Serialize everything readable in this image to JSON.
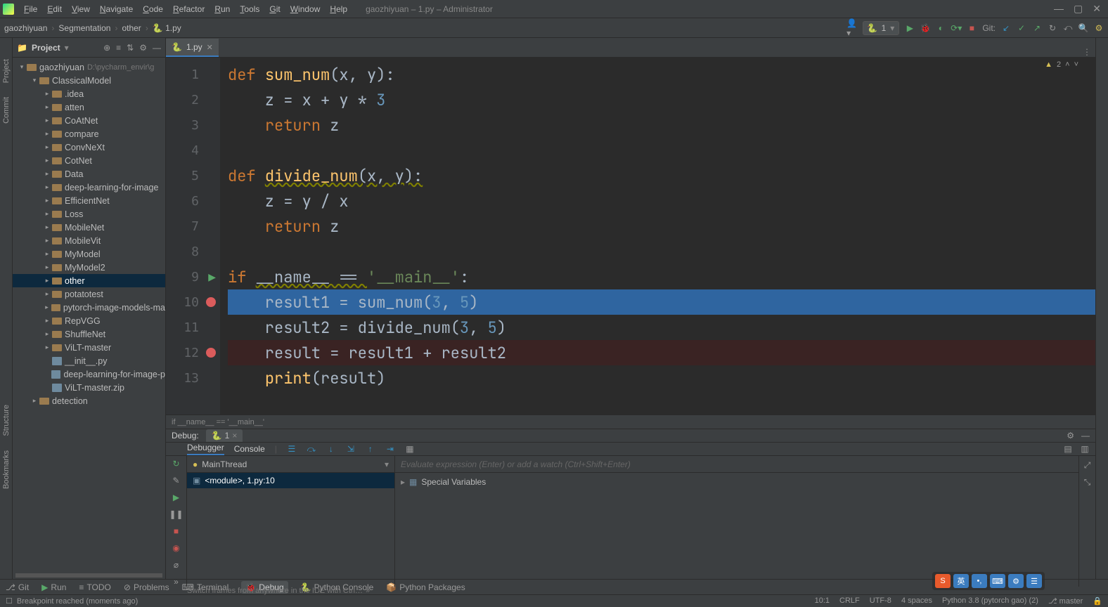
{
  "window": {
    "title": "gaozhiyuan – 1.py – Administrator"
  },
  "menu": [
    "File",
    "Edit",
    "View",
    "Navigate",
    "Code",
    "Refactor",
    "Run",
    "Tools",
    "Git",
    "Window",
    "Help"
  ],
  "breadcrumbs": [
    "gaozhiyuan",
    "Segmentation",
    "other",
    "1.py"
  ],
  "run_config": {
    "label": "1"
  },
  "toolbar_git_label": "Git:",
  "project_panel": {
    "title": "Project"
  },
  "tree": [
    {
      "lvl": 1,
      "caret": "▾",
      "label": "gaozhiyuan",
      "hint": "D:\\pycharm_envir\\g"
    },
    {
      "lvl": 2,
      "caret": "▾",
      "label": "ClassicalModel"
    },
    {
      "lvl": 3,
      "caret": "▸",
      "label": ".idea"
    },
    {
      "lvl": 3,
      "caret": "▸",
      "label": "atten"
    },
    {
      "lvl": 3,
      "caret": "▸",
      "label": "CoAtNet"
    },
    {
      "lvl": 3,
      "caret": "▸",
      "label": "compare"
    },
    {
      "lvl": 3,
      "caret": "▸",
      "label": "ConvNeXt"
    },
    {
      "lvl": 3,
      "caret": "▸",
      "label": "CotNet"
    },
    {
      "lvl": 3,
      "caret": "▸",
      "label": "Data"
    },
    {
      "lvl": 3,
      "caret": "▸",
      "label": "deep-learning-for-image"
    },
    {
      "lvl": 3,
      "caret": "▸",
      "label": "EfficientNet"
    },
    {
      "lvl": 3,
      "caret": "▸",
      "label": "Loss"
    },
    {
      "lvl": 3,
      "caret": "▸",
      "label": "MobileNet"
    },
    {
      "lvl": 3,
      "caret": "▸",
      "label": "MobileVit"
    },
    {
      "lvl": 3,
      "caret": "▸",
      "label": "MyModel"
    },
    {
      "lvl": 3,
      "caret": "▸",
      "label": "MyModel2"
    },
    {
      "lvl": 3,
      "caret": "▸",
      "label": "other",
      "selected": true
    },
    {
      "lvl": 3,
      "caret": "▸",
      "label": "potatotest"
    },
    {
      "lvl": 3,
      "caret": "▸",
      "label": "pytorch-image-models-ma"
    },
    {
      "lvl": 3,
      "caret": "▸",
      "label": "RepVGG"
    },
    {
      "lvl": 3,
      "caret": "▸",
      "label": "ShuffleNet"
    },
    {
      "lvl": 3,
      "caret": "▸",
      "label": "ViLT-master"
    },
    {
      "lvl": 3,
      "caret": "",
      "label": "__init__.py",
      "file": true
    },
    {
      "lvl": 3,
      "caret": "",
      "label": "deep-learning-for-image-p",
      "file": true
    },
    {
      "lvl": 3,
      "caret": "",
      "label": "ViLT-master.zip",
      "file": true
    },
    {
      "lvl": 2,
      "caret": "▸",
      "label": "detection"
    }
  ],
  "tab": {
    "label": "1.py"
  },
  "editor_status": {
    "warnings": "2"
  },
  "code_breadcrumb": "if __name__ == '__main__'",
  "code": {
    "lines": [
      {
        "n": 1,
        "tokens": [
          {
            "t": "def ",
            "c": "kw"
          },
          {
            "t": "sum_num",
            "c": "fn"
          },
          {
            "t": "(x, y):",
            "c": "id"
          }
        ]
      },
      {
        "n": 2,
        "tokens": [
          {
            "t": "    z = x + y * ",
            "c": "id"
          },
          {
            "t": "3",
            "c": "num"
          }
        ]
      },
      {
        "n": 3,
        "tokens": [
          {
            "t": "    ",
            "c": "id"
          },
          {
            "t": "return ",
            "c": "kw"
          },
          {
            "t": "z",
            "c": "id"
          }
        ]
      },
      {
        "n": 4,
        "tokens": []
      },
      {
        "n": 5,
        "tokens": [
          {
            "t": "def ",
            "c": "kw"
          },
          {
            "t": "divide_num",
            "c": "fn wavy"
          },
          {
            "t": "(x, y):",
            "c": "id wavy"
          }
        ]
      },
      {
        "n": 6,
        "tokens": [
          {
            "t": "    z = y / x",
            "c": "id"
          }
        ]
      },
      {
        "n": 7,
        "tokens": [
          {
            "t": "    ",
            "c": "id"
          },
          {
            "t": "return ",
            "c": "kw"
          },
          {
            "t": "z",
            "c": "id"
          }
        ]
      },
      {
        "n": 8,
        "tokens": []
      },
      {
        "n": 9,
        "tokens": [
          {
            "t": "if ",
            "c": "kw"
          },
          {
            "t": "__name__ == ",
            "c": "id wavy"
          },
          {
            "t": "'__main__'",
            "c": "str"
          },
          {
            "t": ":",
            "c": "id"
          }
        ],
        "run": true
      },
      {
        "n": 10,
        "tokens": [
          {
            "t": "    result1 = sum_num(",
            "c": "id"
          },
          {
            "t": "3",
            "c": "num"
          },
          {
            "t": ", ",
            "c": "id"
          },
          {
            "t": "5",
            "c": "num"
          },
          {
            "t": ")",
            "c": "id"
          }
        ],
        "bp": true,
        "exec": true
      },
      {
        "n": 11,
        "tokens": [
          {
            "t": "    result2 = divide_num(",
            "c": "id"
          },
          {
            "t": "3",
            "c": "num"
          },
          {
            "t": ", ",
            "c": "id"
          },
          {
            "t": "5",
            "c": "num"
          },
          {
            "t": ")",
            "c": "id"
          }
        ]
      },
      {
        "n": 12,
        "tokens": [
          {
            "t": "    result = result1 + result2",
            "c": "id"
          }
        ],
        "bp": true,
        "bpline": true
      },
      {
        "n": 13,
        "tokens": [
          {
            "t": "    ",
            "c": "id"
          },
          {
            "t": "print",
            "c": "fn"
          },
          {
            "t": "(result)",
            "c": "id"
          }
        ]
      }
    ]
  },
  "debug": {
    "title": "Debug:",
    "run_label": "1",
    "tab_debugger": "Debugger",
    "tab_console": "Console",
    "thread": "MainThread",
    "frame": "<module>, 1.py:10",
    "eval_placeholder": "Evaluate expression (Enter) or add a watch (Ctrl+Shift+Enter)",
    "special_vars": "Special Variables",
    "tip": "Switch frames from anywhere in the IDE with Ctrl…"
  },
  "bottom_tools": {
    "git": "Git",
    "run": "Run",
    "todo": "TODO",
    "problems": "Problems",
    "terminal": "Terminal",
    "debug": "Debug",
    "pyconsole": "Python Console",
    "pypkg": "Python Packages"
  },
  "status": {
    "msg": "Breakpoint reached (moments ago)",
    "pos": "10:1",
    "eol": "CRLF",
    "enc": "UTF-8",
    "indent": "4 spaces",
    "interp": "Python 3.8 (pytorch gao) (2)",
    "branch": "master"
  },
  "ime": [
    "英",
    "•,",
    "⌨",
    "⚙",
    "☰"
  ]
}
